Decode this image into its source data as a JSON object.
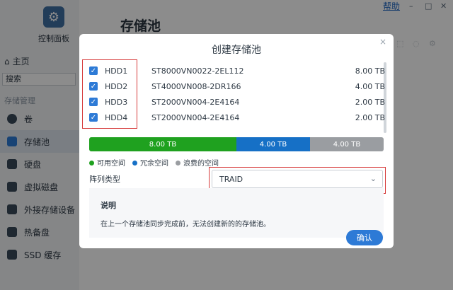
{
  "topbar": {
    "help": "帮助",
    "controls": [
      "–",
      "□",
      "✕"
    ]
  },
  "sidebar": {
    "app_label": "控制面板",
    "home": "主页",
    "search_placeholder": "搜索",
    "section": "存储管理",
    "items": [
      {
        "label": "卷",
        "icon": "volume-icon"
      },
      {
        "label": "存储池",
        "icon": "storage-pool-icon"
      },
      {
        "label": "硬盘",
        "icon": "disk-icon"
      },
      {
        "label": "虚拟磁盘",
        "icon": "virtual-disk-icon"
      },
      {
        "label": "外接存储设备",
        "icon": "usb-icon"
      },
      {
        "label": "热备盘",
        "icon": "spare-disk-icon"
      },
      {
        "label": "SSD 缓存",
        "icon": "ssd-cache-icon"
      }
    ],
    "active_index": 1
  },
  "page": {
    "title": "存储池"
  },
  "modal": {
    "title": "创建存储池",
    "disks": [
      {
        "name": "HDD1",
        "model": "ST8000VN0022-2EL112",
        "size": "8.00 TB",
        "checked": true
      },
      {
        "name": "HDD2",
        "model": "ST4000VN008-2DR166",
        "size": "4.00 TB",
        "checked": true
      },
      {
        "name": "HDD3",
        "model": "ST2000VN004-2E4164",
        "size": "2.00 TB",
        "checked": true
      },
      {
        "name": "HDD4",
        "model": "ST2000VN004-2E4164",
        "size": "2.00 TB",
        "checked": true
      }
    ],
    "capacity_bar": {
      "segments": [
        {
          "label": "8.00 TB",
          "fraction": 0.5,
          "color": "#1fa11f"
        },
        {
          "label": "4.00 TB",
          "fraction": 0.25,
          "color": "#1670c6"
        },
        {
          "label": "4.00 TB",
          "fraction": 0.25,
          "color": "#9a9da1"
        }
      ]
    },
    "legend": [
      {
        "label": "可用空间",
        "color": "#1fa11f"
      },
      {
        "label": "冗余空间",
        "color": "#1670c6"
      },
      {
        "label": "浪费的空间",
        "color": "#9a9da1"
      }
    ],
    "array_type_label": "阵列类型",
    "array_type_value": "TRAID",
    "info_title": "说明",
    "info_text": "在上一个存储池同步完成前，无法创建新的的存储池。",
    "confirm": "确认"
  }
}
